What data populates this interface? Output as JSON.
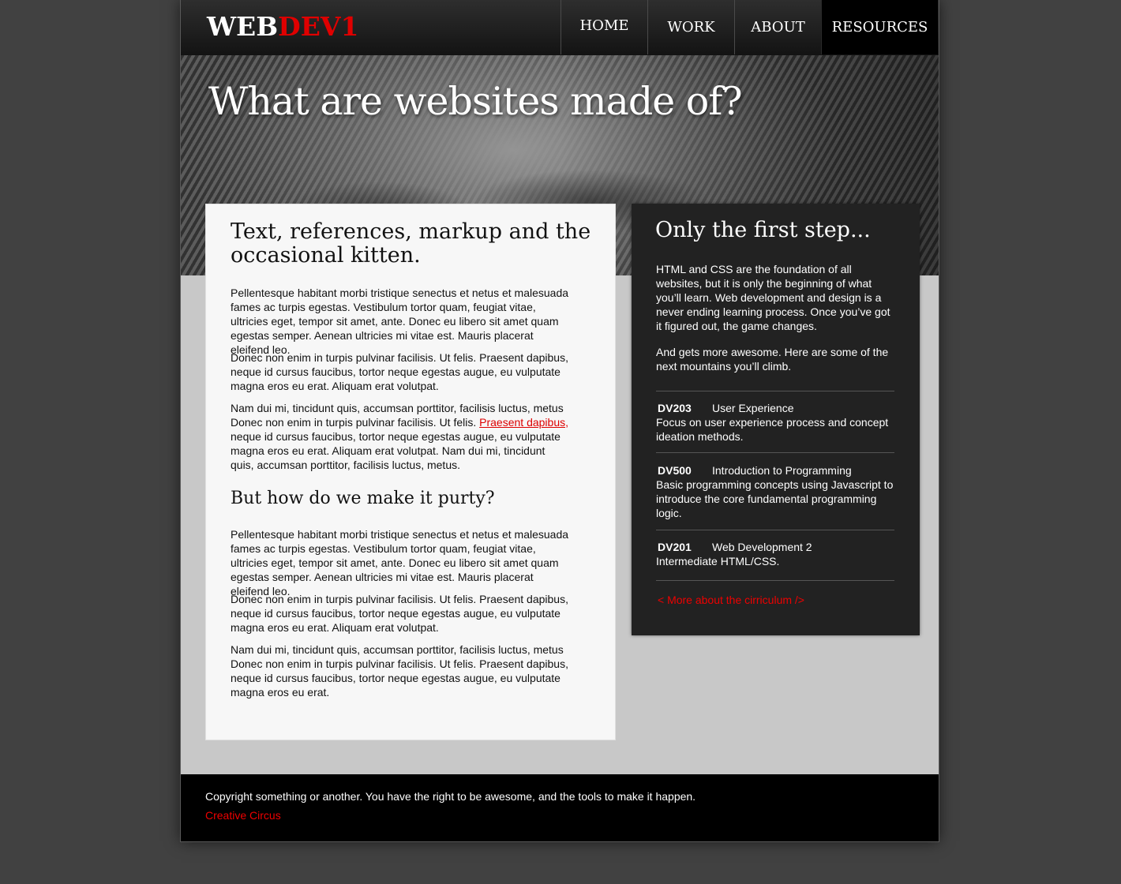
{
  "logo": {
    "part1": "WEB",
    "part2": "DEV1"
  },
  "nav": [
    {
      "label": "HOME"
    },
    {
      "label": "WORK"
    },
    {
      "label": "ABOUT"
    },
    {
      "label": "RESOURCES",
      "active": true
    }
  ],
  "hero": {
    "title": "What are websites made of?"
  },
  "main": {
    "heading": "Text, references, markup and the occasional kitten.",
    "p1": "Pellentesque habitant morbi tristique senectus et netus et malesuada fames ac turpis egestas. Vestibulum tortor quam, feugiat vitae, ultricies eget, tempor sit amet, ante. Donec eu libero sit amet quam egestas semper. Aenean ultricies mi vitae est. Mauris placerat eleifend leo.",
    "p2": "Donec non enim in turpis pulvinar facilisis. Ut felis. Praesent dapibus, neque id cursus faucibus, tortor neque egestas augue, eu vulputate magna eros eu erat. Aliquam erat volutpat.",
    "p3_before": "Nam dui mi, tincidunt quis, accumsan porttitor, facilisis luctus, metus Donec non enim in turpis pulvinar facilisis. Ut felis. ",
    "p3_link": "Praesent dapibus,",
    "p3_after": " neque id cursus faucibus, tortor neque egestas augue, eu vulputate magna eros eu erat. Aliquam erat volutpat. Nam dui mi, tincidunt quis, accumsan porttitor, facilisis luctus, metus.",
    "subheading": "But how do we make it purty?",
    "p4": "Pellentesque habitant morbi tristique senectus et netus et malesuada fames ac turpis egestas. Vestibulum tortor quam, feugiat vitae, ultricies eget, tempor sit amet, ante. Donec eu libero sit amet quam egestas semper. Aenean ultricies mi vitae est. Mauris placerat eleifend leo.",
    "p5": "Donec non enim in turpis pulvinar facilisis. Ut felis. Praesent dapibus, neque id cursus faucibus, tortor neque egestas augue, eu vulputate magna eros eu erat. Aliquam erat volutpat.",
    "p6": "Nam dui mi, tincidunt quis, accumsan porttitor, facilisis luctus, metus Donec non enim in turpis pulvinar facilisis. Ut felis. Praesent dapibus, neque id cursus faucibus, tortor neque egestas augue, eu vulputate magna eros eu erat."
  },
  "sidebar": {
    "heading": "Only the first step...",
    "p1": "HTML and CSS are the foundation of all websites, but it is only the beginning of what you’ll learn. Web development and design is a never ending learning process. Once you’ve got it figured out, the game changes.",
    "p2": "And gets more awesome. Here are some of the next mountains you’ll climb.",
    "courses": [
      {
        "code": "DV203",
        "title": "User Experience",
        "desc": "Focus on user experience process and concept ideation methods."
      },
      {
        "code": "DV500",
        "title": "Introduction to Programming",
        "desc": "Basic programming concepts using Javascript to introduce the core fundamental programming logic."
      },
      {
        "code": "DV201",
        "title": "Web Development 2",
        "desc": "Intermediate HTML/CSS."
      }
    ],
    "link": "< More about the cirriculum />"
  },
  "footer": {
    "copyright": "Copyright something or another. You have the right to be awesome, and the tools to make it happen.",
    "link": "Creative Circus"
  },
  "colors": {
    "accent": "#e00000",
    "background": "#414141",
    "content": "#c8c8c8",
    "sidebar": "#222222"
  }
}
